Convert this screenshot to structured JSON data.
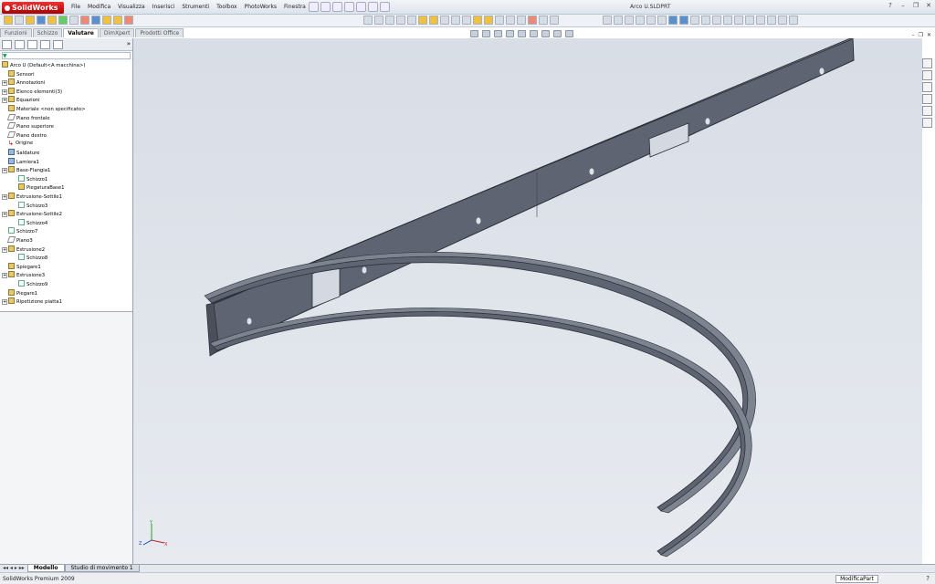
{
  "app": {
    "logo": "SolidWorks",
    "window_title": "Arco U.SLDPRT",
    "menu": [
      "File",
      "Modifica",
      "Visualizza",
      "Inserisci",
      "Strumenti",
      "Toolbox",
      "PhotoWorks",
      "Finestra"
    ],
    "help_glyph": "?"
  },
  "command_tabs": [
    {
      "label": "Funzioni",
      "active": false
    },
    {
      "label": "Schizzo",
      "active": false
    },
    {
      "label": "Valutare",
      "active": true
    },
    {
      "label": "DimXpert",
      "active": false
    },
    {
      "label": "Prodotti Office",
      "active": false
    }
  ],
  "tree": {
    "root": "Arco U  (Default<A macchina>)",
    "items": [
      {
        "label": "Sensori",
        "icon": "sensor-icon",
        "expand": false,
        "indent": 1
      },
      {
        "label": "Annotazioni",
        "icon": "annotation-icon",
        "expand": true,
        "indent": 1
      },
      {
        "label": "Elenco elementi(3)",
        "icon": "list-icon",
        "expand": true,
        "indent": 1
      },
      {
        "label": "Equazioni",
        "icon": "equation-icon",
        "expand": true,
        "indent": 1
      },
      {
        "label": "Materiale <non specificato>",
        "icon": "material-icon",
        "expand": false,
        "indent": 1
      },
      {
        "label": "Piano frontale",
        "icon": "plane-icon",
        "expand": false,
        "indent": 1
      },
      {
        "label": "Piano superiore",
        "icon": "plane-icon",
        "expand": false,
        "indent": 1
      },
      {
        "label": "Piano destro",
        "icon": "plane-icon",
        "expand": false,
        "indent": 1
      },
      {
        "label": "Origine",
        "icon": "origin-icon",
        "expand": false,
        "indent": 1
      },
      {
        "label": "Saldature",
        "icon": "weldment-icon",
        "expand": false,
        "indent": 1
      },
      {
        "label": "Lamiera1",
        "icon": "sheetmetal-icon",
        "expand": false,
        "indent": 1
      },
      {
        "label": "Base-Flangia1",
        "icon": "feature-icon",
        "expand": true,
        "indent": 1
      },
      {
        "label": "Schizzo1",
        "icon": "sketch-icon",
        "expand": false,
        "indent": 2
      },
      {
        "label": "PiegaturaBase1",
        "icon": "bend-icon",
        "expand": false,
        "indent": 2
      },
      {
        "label": "Estrusione-Sottile1",
        "icon": "feature-icon",
        "expand": true,
        "indent": 1
      },
      {
        "label": "Schizzo3",
        "icon": "sketch-icon",
        "expand": false,
        "indent": 2
      },
      {
        "label": "Estrusione-Sottile2",
        "icon": "feature-icon",
        "expand": true,
        "indent": 1
      },
      {
        "label": "Schizzo4",
        "icon": "sketch-icon",
        "expand": false,
        "indent": 2
      },
      {
        "label": "Schizzo7",
        "icon": "sketch-icon",
        "expand": false,
        "indent": 1
      },
      {
        "label": "Piano3",
        "icon": "plane-icon",
        "expand": false,
        "indent": 1
      },
      {
        "label": "Estrusione2",
        "icon": "feature-icon",
        "expand": true,
        "indent": 1
      },
      {
        "label": "Schizzo8",
        "icon": "sketch-icon",
        "expand": false,
        "indent": 2
      },
      {
        "label": "Spiegare1",
        "icon": "unfold-icon",
        "expand": false,
        "indent": 1
      },
      {
        "label": "Estrusione3",
        "icon": "feature-icon",
        "expand": true,
        "indent": 1
      },
      {
        "label": "Schizzo9",
        "icon": "sketch-icon",
        "expand": false,
        "indent": 2
      },
      {
        "label": "Piegare1",
        "icon": "fold-icon",
        "expand": false,
        "indent": 1
      },
      {
        "label": "Ripetizione piatta1",
        "icon": "flat-pattern-icon",
        "expand": true,
        "indent": 1
      }
    ]
  },
  "bottom_tabs": [
    {
      "label": "Modello",
      "active": true
    },
    {
      "label": "Studio di movimento 1",
      "active": false
    }
  ],
  "status": {
    "left": "SolidWorks Premium 2009",
    "mode": "ModificaPart"
  },
  "colors": {
    "part": "#5d6370",
    "part_edge": "#2a2e36",
    "viewport_top": "#d8dde6",
    "viewport_bottom": "#e7ebf0",
    "brand": "#c41a1a"
  },
  "triad": {
    "x": "X",
    "y": "Y",
    "z": "Z"
  }
}
